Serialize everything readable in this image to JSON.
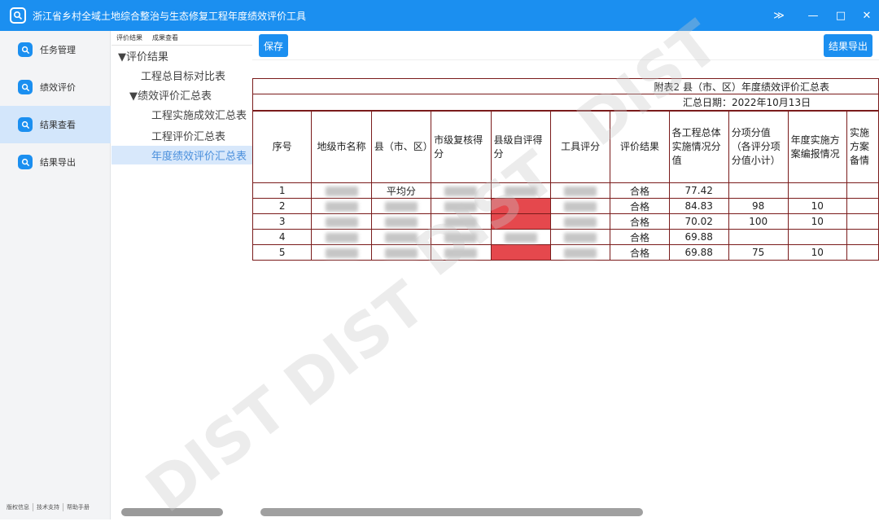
{
  "window": {
    "title": "浙江省乡村全域土地综合整治与生态修复工程年度绩效评价工具",
    "controls": {
      "collapse": "≫",
      "minimize": "—",
      "maximize": "□",
      "close": "✕"
    }
  },
  "leftnav": {
    "items": [
      {
        "label": "任务管理",
        "icon": "search-icon"
      },
      {
        "label": "绩效评价",
        "icon": "search-icon"
      },
      {
        "label": "结果查看",
        "icon": "search-icon",
        "active": true
      },
      {
        "label": "结果导出",
        "icon": "search-icon"
      }
    ],
    "footer": [
      "版权信息",
      "技术支持",
      "帮助手册"
    ]
  },
  "tree": {
    "tabs": [
      "评价结果",
      "成果查看"
    ],
    "nodes": [
      {
        "label": "▼评价结果"
      },
      {
        "label": "工程总目标对比表"
      },
      {
        "label": "▼绩效评价汇总表"
      },
      {
        "label": "工程实施成效汇总表"
      },
      {
        "label": "工程评价汇总表"
      },
      {
        "label": "年度绩效评价汇总表",
        "selected": true
      }
    ]
  },
  "toolbar": {
    "save_label": "保存",
    "export_label": "结果导出"
  },
  "report": {
    "title": "附表2 县（市、区）年度绩效评价汇总表",
    "date": "汇总日期：2022年10月13日",
    "headers": [
      "序号",
      "地级市名称",
      "县（市、区）",
      "市级复核得分",
      "县级自评得分",
      "工具评分",
      "评价结果",
      "各工程总体实施情况分值",
      "分项分值（各评分项分值小计）",
      "年度实施方案编报情况",
      "实施方案备情"
    ],
    "rows": [
      {
        "idx": "1",
        "county": "平均分",
        "result": "合格",
        "overall": "77.42",
        "sub": "",
        "plan": ""
      },
      {
        "idx": "2",
        "county": "",
        "result": "合格",
        "overall": "84.83",
        "sub": "98",
        "plan": "10"
      },
      {
        "idx": "3",
        "county": "",
        "result": "合格",
        "overall": "70.02",
        "sub": "100",
        "plan": "10"
      },
      {
        "idx": "4",
        "county": "",
        "result": "合格",
        "overall": "69.88",
        "sub": "",
        "plan": ""
      },
      {
        "idx": "5",
        "county": "",
        "result": "合格",
        "overall": "69.88",
        "sub": "75",
        "plan": "10"
      }
    ],
    "highlight_color": "#e5484d"
  },
  "watermark": "DIST",
  "accent": "#1b8ff0"
}
